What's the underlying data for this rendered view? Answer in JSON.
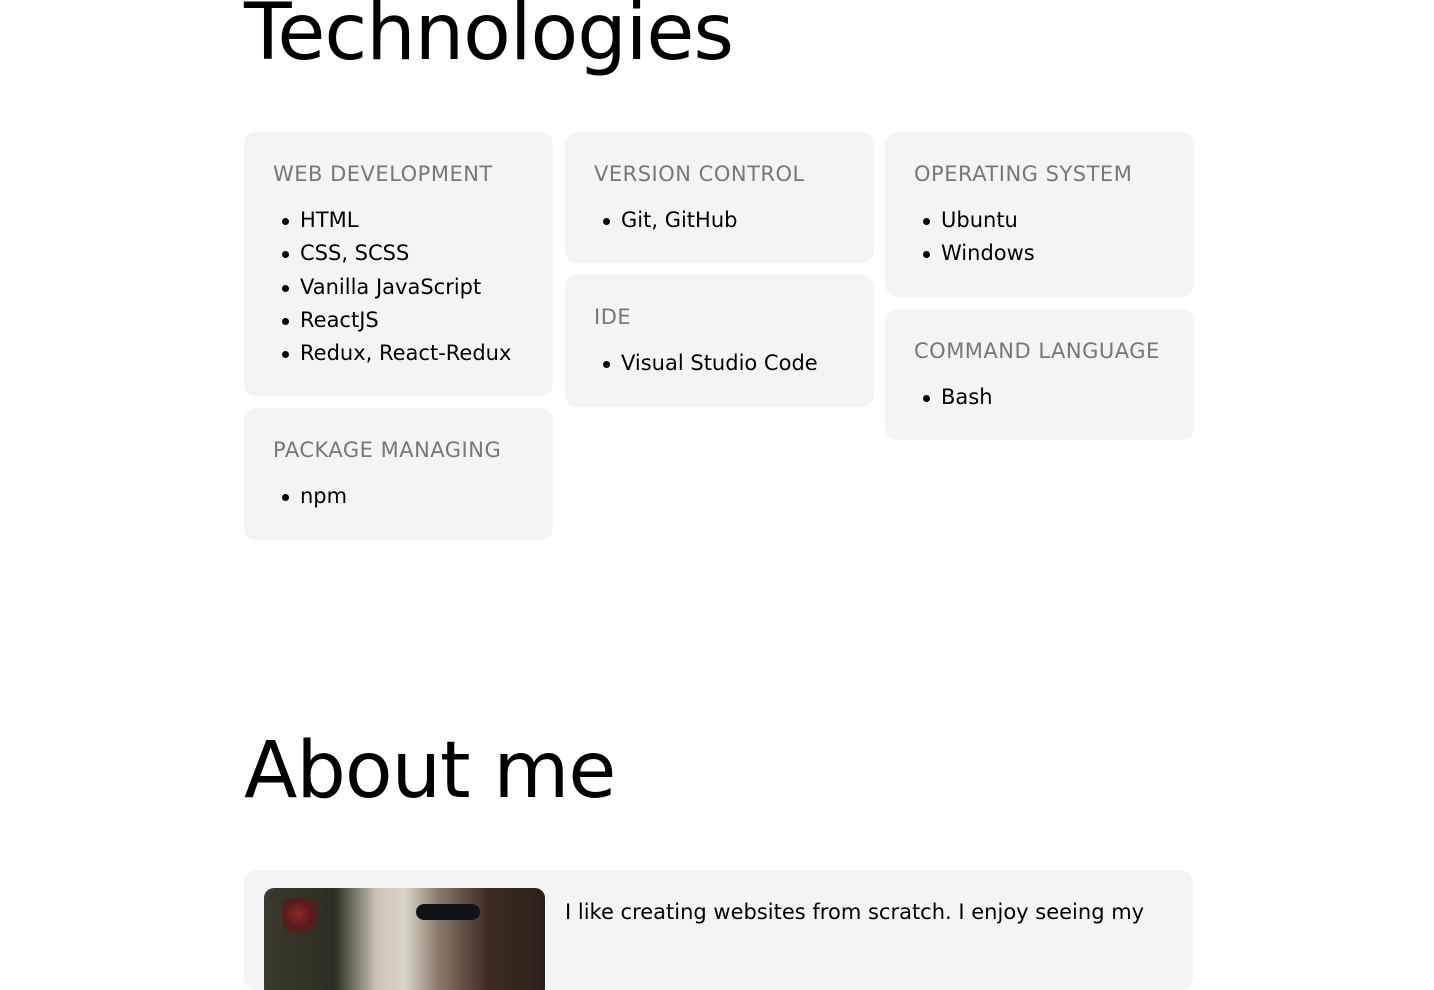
{
  "technologies": {
    "title": "Technologies",
    "columns": [
      [
        {
          "title": "WEB DEVELOPMENT",
          "items": [
            "HTML",
            "CSS, SCSS",
            "Vanilla JavaScript",
            "ReactJS",
            "Redux, React-Redux"
          ]
        },
        {
          "title": "PACKAGE MANAGING",
          "items": [
            "npm"
          ]
        }
      ],
      [
        {
          "title": "VERSION CONTROL",
          "items": [
            "Git, GitHub"
          ]
        },
        {
          "title": "IDE",
          "items": [
            "Visual Studio Code"
          ]
        }
      ],
      [
        {
          "title": "OPERATING SYSTEM",
          "items": [
            "Ubuntu",
            "Windows"
          ]
        },
        {
          "title": "COMMAND LANGUAGE",
          "items": [
            "Bash"
          ]
        }
      ]
    ]
  },
  "about": {
    "title": "About me",
    "text": "I like creating websites from scratch. I enjoy seeing my"
  }
}
